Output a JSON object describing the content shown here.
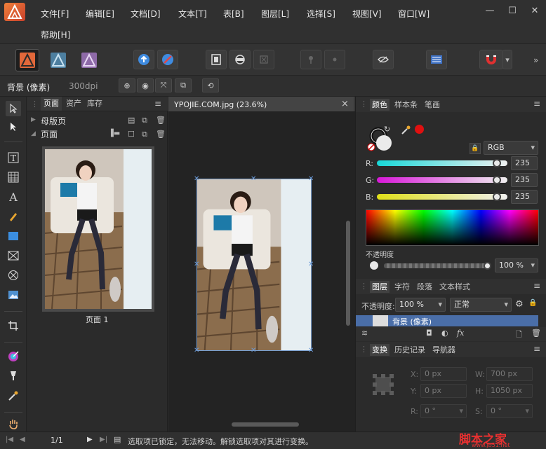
{
  "menu": {
    "items": [
      "文件[F]",
      "编辑[E]",
      "文档[D]",
      "文本[T]",
      "表[B]",
      "图层[L]",
      "选择[S]",
      "视图[V]",
      "窗口[W]"
    ],
    "second_row": "帮助[H]"
  },
  "window_controls": {
    "minimize": "—",
    "maximize": "☐",
    "close": "✕"
  },
  "context": {
    "layer_label": "背景 (像素)",
    "dpi": "300dpi"
  },
  "pages_panel": {
    "tabs": [
      "页面",
      "资产",
      "库存"
    ],
    "master_label": "母版页",
    "pages_label": "页面",
    "page_caption": "页面 1"
  },
  "document": {
    "tab_title": "YPOJIE.COM.jpg (23.6%)",
    "close": "×"
  },
  "color_panel": {
    "tabs": [
      "颜色",
      "样本条",
      "笔画"
    ],
    "model": "RGB",
    "r_label": "R:",
    "g_label": "G:",
    "b_label": "B:",
    "r": "235",
    "g": "235",
    "b": "235",
    "r_fraction": 0.92,
    "g_fraction": 0.92,
    "b_fraction": 0.92,
    "opacity_label": "不透明度",
    "opacity_value": "100 %",
    "accent_swatch": "#e01010"
  },
  "layers_panel": {
    "tabs": [
      "图层",
      "字符",
      "段落",
      "文本样式"
    ],
    "opacity_label": "不透明度:",
    "opacity_value": "100 %",
    "blend_mode": "正常",
    "layer_name": "背景 (像素)",
    "fx_label": "fx"
  },
  "transform_panel": {
    "tabs": [
      "变换",
      "历史记录",
      "导航器"
    ],
    "x_label": "X:",
    "y_label": "Y:",
    "w_label": "W:",
    "h_label": "H:",
    "r_label": "R:",
    "s_label": "S:",
    "x": "0 px",
    "y": "0 px",
    "w": "700 px",
    "h": "1050 px",
    "r": "0 °",
    "s": "0 °"
  },
  "status": {
    "page": "1/1",
    "message": "选取项已锁定，无法移动。解锁选取项对其进行变换。",
    "watermark_cn": "脚本之家",
    "watermark_url": "www.jb51.net"
  },
  "colors": {
    "accent_blue": "#4a90d9",
    "selection_row": "#4a6ea8",
    "red_swatch": "#e01010"
  }
}
